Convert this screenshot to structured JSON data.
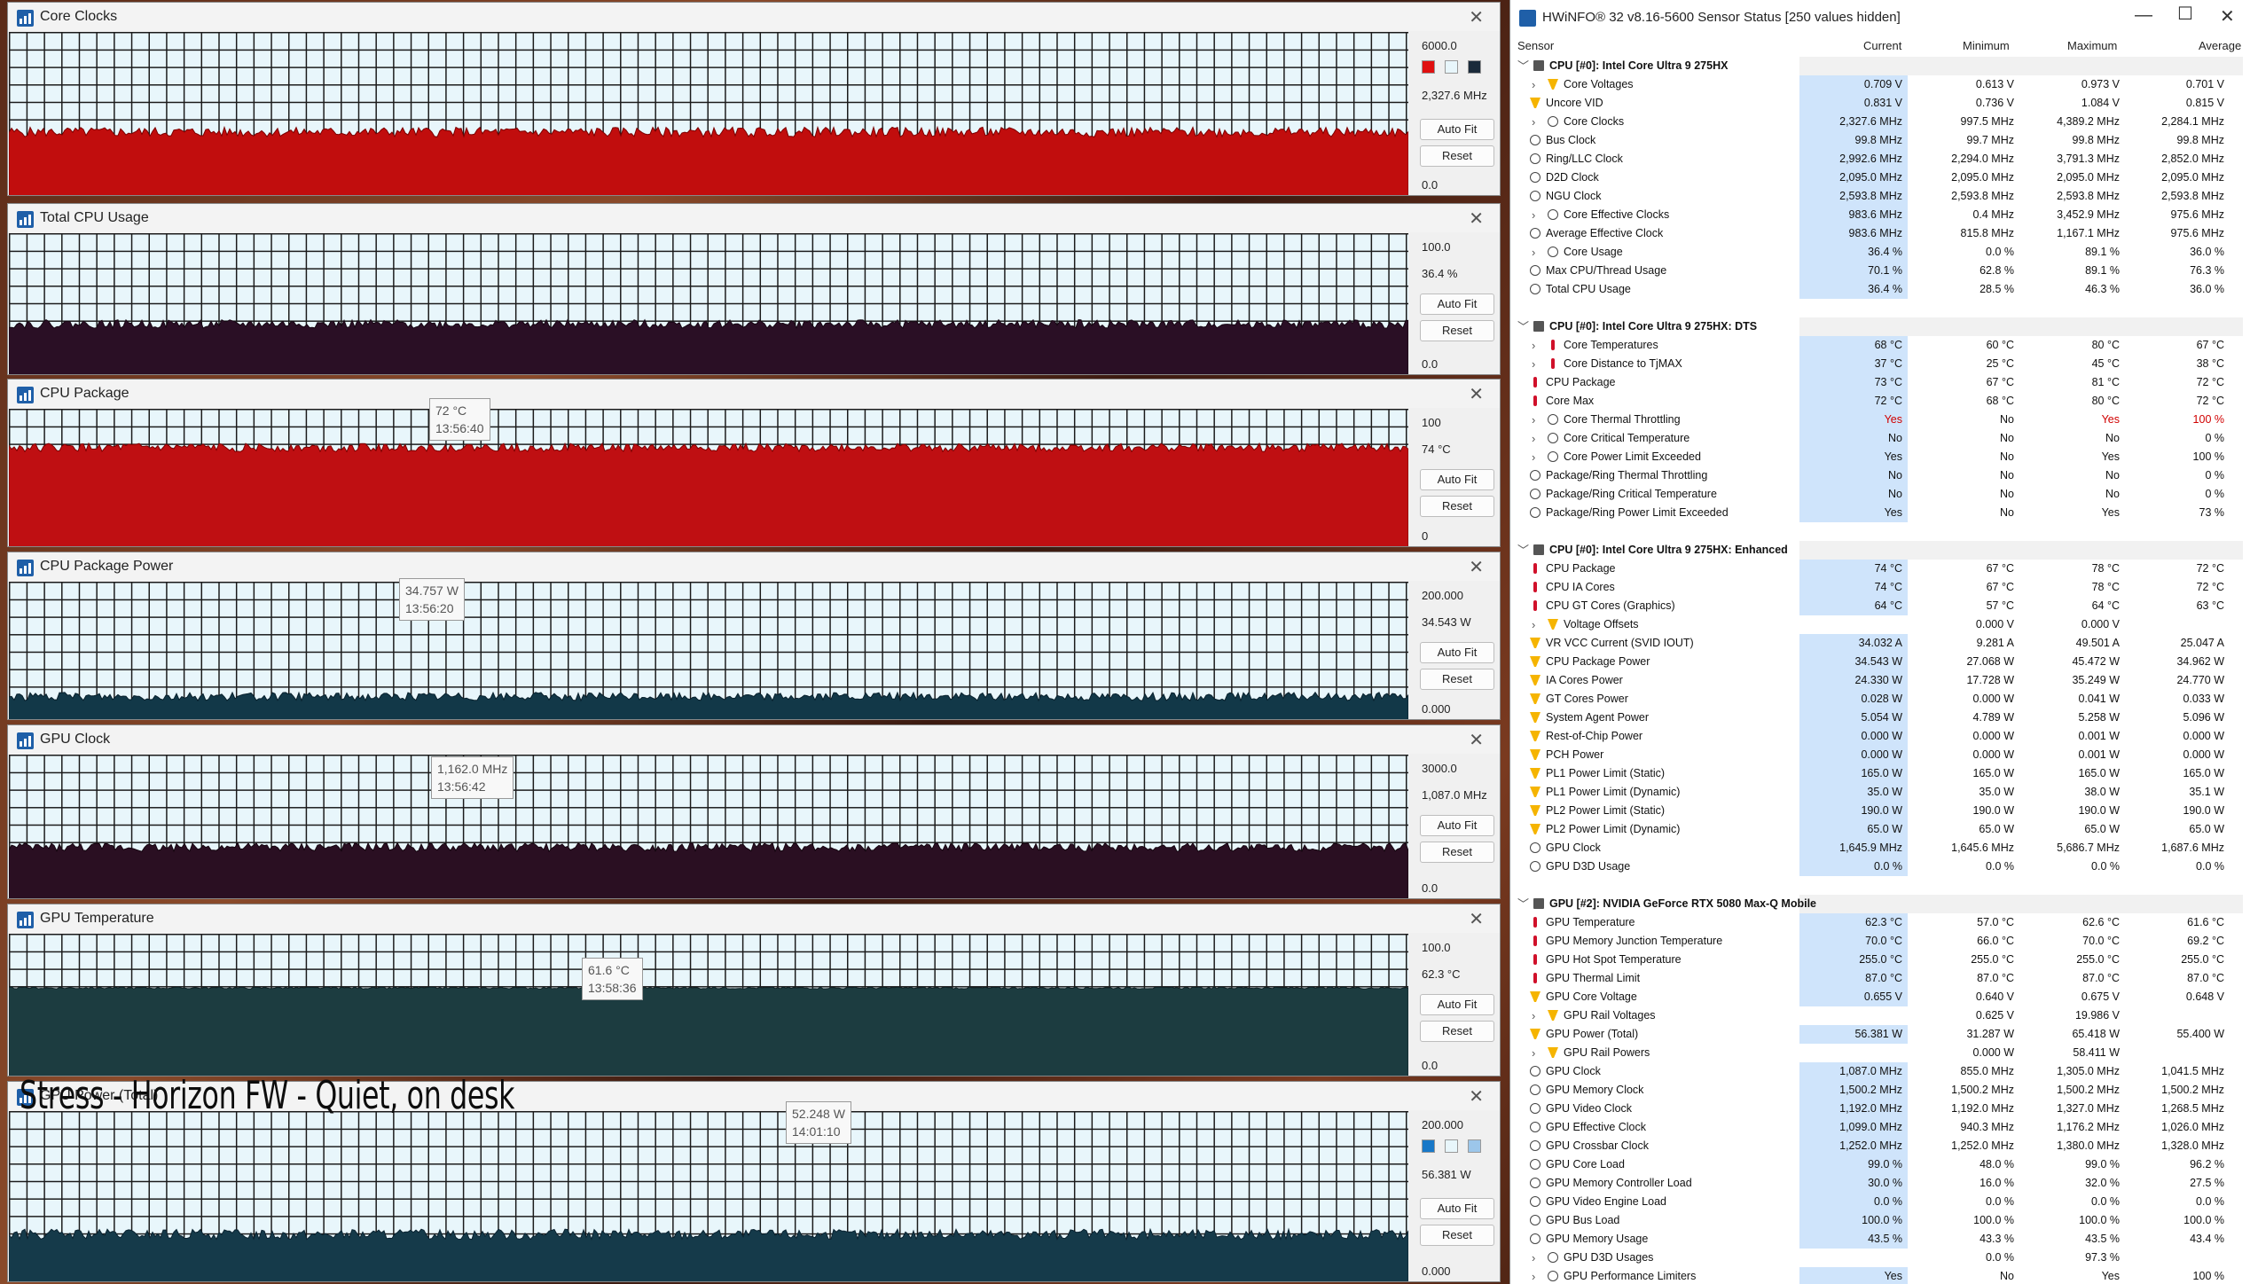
{
  "caption": "Stress - Horizon FW - Quiet, on desk",
  "graphs": [
    {
      "title": "Core Clocks",
      "max": "6000.0",
      "current": "2,327.6 MHz",
      "min": "0.0",
      "fill": "#c10d0d",
      "line": "#7a0000",
      "level": 0.39,
      "swatches": [
        "#e01010",
        "#e8f6fb",
        "#1a2a3a"
      ],
      "tooltip": null
    },
    {
      "title": "Total CPU Usage",
      "max": "100.0",
      "current": "36.4 %",
      "min": "0.0",
      "fill": "#2a0f25",
      "line": "#150612",
      "level": 0.36,
      "swatches": [],
      "tooltip": null
    },
    {
      "title": "CPU Package",
      "max": "100",
      "current": "74 °C",
      "min": "0",
      "fill": "#bf0f12",
      "line": "#7a0000",
      "level": 0.72,
      "swatches": [],
      "tooltip": {
        "value": "72 °C",
        "time": "13:56:40"
      }
    },
    {
      "title": "CPU Package Power",
      "max": "200.000",
      "current": "34.543 W",
      "min": "0.000",
      "fill": "#123848",
      "line": "#08202c",
      "level": 0.17,
      "swatches": [],
      "tooltip": {
        "value": "34.757 W",
        "time": "13:56:20"
      }
    },
    {
      "title": "GPU Clock",
      "max": "3000.0",
      "current": "1,087.0 MHz",
      "min": "0.0",
      "fill": "#2a0f22",
      "line": "#14050f",
      "level": 0.36,
      "swatches": [],
      "tooltip": {
        "value": "1,162.0 MHz",
        "time": "13:56:42"
      }
    },
    {
      "title": "GPU Temperature",
      "max": "100.0",
      "current": "62.3 °C",
      "min": "0.0",
      "fill": "#1c3c40",
      "line": "#102428",
      "level": 0.62,
      "swatches": [],
      "tooltip": {
        "value": "61.6 °C",
        "time": "13:58:36"
      }
    },
    {
      "title": "GPU Power (Total)",
      "max": "200.000",
      "current": "56.381 W",
      "min": "0.000",
      "fill": "#153a4a",
      "line": "#0a2230",
      "level": 0.28,
      "swatches": [
        "#1878c8",
        "#e8f6fb",
        "#9cc6ea"
      ],
      "tooltip": {
        "value": "52.248 W",
        "time": "14:01:10"
      }
    }
  ],
  "buttons": {
    "autofit": "Auto Fit",
    "reset": "Reset"
  },
  "hwinfo": {
    "title": "HWiNFO® 32 v8.16-5600 Sensor Status [250 values hidden]",
    "columns": {
      "sensor": "Sensor",
      "current": "Current",
      "minimum": "Minimum",
      "maximum": "Maximum",
      "average": "Average"
    },
    "rows": [
      {
        "t": "h",
        "n": "CPU [#0]: Intel Core Ultra 9 275HX"
      },
      {
        "t": "r",
        "i": "bolt",
        "e": 1,
        "n": "Core Voltages",
        "c": "0.709 V",
        "mi": "0.613 V",
        "ma": "0.973 V",
        "av": "0.701 V"
      },
      {
        "t": "r",
        "i": "bolt",
        "e": 0,
        "n": "Uncore VID",
        "c": "0.831 V",
        "mi": "0.736 V",
        "ma": "1.084 V",
        "av": "0.815 V"
      },
      {
        "t": "r",
        "i": "clock",
        "e": 1,
        "n": "Core Clocks",
        "c": "2,327.6 MHz",
        "mi": "997.5 MHz",
        "ma": "4,389.2 MHz",
        "av": "2,284.1 MHz"
      },
      {
        "t": "r",
        "i": "clock",
        "e": 0,
        "n": "Bus Clock",
        "c": "99.8 MHz",
        "mi": "99.7 MHz",
        "ma": "99.8 MHz",
        "av": "99.8 MHz"
      },
      {
        "t": "r",
        "i": "clock",
        "e": 0,
        "n": "Ring/LLC Clock",
        "c": "2,992.6 MHz",
        "mi": "2,294.0 MHz",
        "ma": "3,791.3 MHz",
        "av": "2,852.0 MHz"
      },
      {
        "t": "r",
        "i": "clock",
        "e": 0,
        "n": "D2D Clock",
        "c": "2,095.0 MHz",
        "mi": "2,095.0 MHz",
        "ma": "2,095.0 MHz",
        "av": "2,095.0 MHz"
      },
      {
        "t": "r",
        "i": "clock",
        "e": 0,
        "n": "NGU Clock",
        "c": "2,593.8 MHz",
        "mi": "2,593.8 MHz",
        "ma": "2,593.8 MHz",
        "av": "2,593.8 MHz"
      },
      {
        "t": "r",
        "i": "clock",
        "e": 1,
        "n": "Core Effective Clocks",
        "c": "983.6 MHz",
        "mi": "0.4 MHz",
        "ma": "3,452.9 MHz",
        "av": "975.6 MHz"
      },
      {
        "t": "r",
        "i": "clock",
        "e": 0,
        "n": "Average Effective Clock",
        "c": "983.6 MHz",
        "mi": "815.8 MHz",
        "ma": "1,167.1 MHz",
        "av": "975.6 MHz"
      },
      {
        "t": "r",
        "i": "clock",
        "e": 1,
        "n": "Core Usage",
        "c": "36.4 %",
        "mi": "0.0 %",
        "ma": "89.1 %",
        "av": "36.0 %"
      },
      {
        "t": "r",
        "i": "clock",
        "e": 0,
        "n": "Max CPU/Thread Usage",
        "c": "70.1 %",
        "mi": "62.8 %",
        "ma": "89.1 %",
        "av": "76.3 %"
      },
      {
        "t": "r",
        "i": "clock",
        "e": 0,
        "n": "Total CPU Usage",
        "c": "36.4 %",
        "mi": "28.5 %",
        "ma": "46.3 %",
        "av": "36.0 %"
      },
      {
        "t": "s"
      },
      {
        "t": "h",
        "n": "CPU [#0]: Intel Core Ultra 9 275HX: DTS"
      },
      {
        "t": "r",
        "i": "therm",
        "e": 1,
        "n": "Core Temperatures",
        "c": "68 °C",
        "mi": "60 °C",
        "ma": "80 °C",
        "av": "67 °C"
      },
      {
        "t": "r",
        "i": "therm",
        "e": 1,
        "n": "Core Distance to TjMAX",
        "c": "37 °C",
        "mi": "25 °C",
        "ma": "45 °C",
        "av": "38 °C"
      },
      {
        "t": "r",
        "i": "therm",
        "e": 0,
        "n": "CPU Package",
        "c": "73 °C",
        "mi": "67 °C",
        "ma": "81 °C",
        "av": "72 °C"
      },
      {
        "t": "r",
        "i": "therm",
        "e": 0,
        "n": "Core Max",
        "c": "72 °C",
        "mi": "68 °C",
        "ma": "80 °C",
        "av": "72 °C"
      },
      {
        "t": "r",
        "i": "clock",
        "e": 1,
        "n": "Core Thermal Throttling",
        "c": "Yes",
        "mi": "No",
        "ma": "Yes",
        "av": "100 %",
        "red": 1
      },
      {
        "t": "r",
        "i": "clock",
        "e": 1,
        "n": "Core Critical Temperature",
        "c": "No",
        "mi": "No",
        "ma": "No",
        "av": "0 %"
      },
      {
        "t": "r",
        "i": "clock",
        "e": 1,
        "n": "Core Power Limit Exceeded",
        "c": "Yes",
        "mi": "No",
        "ma": "Yes",
        "av": "100 %"
      },
      {
        "t": "r",
        "i": "clock",
        "e": 0,
        "n": "Package/Ring Thermal Throttling",
        "c": "No",
        "mi": "No",
        "ma": "No",
        "av": "0 %"
      },
      {
        "t": "r",
        "i": "clock",
        "e": 0,
        "n": "Package/Ring Critical Temperature",
        "c": "No",
        "mi": "No",
        "ma": "No",
        "av": "0 %"
      },
      {
        "t": "r",
        "i": "clock",
        "e": 0,
        "n": "Package/Ring Power Limit Exceeded",
        "c": "Yes",
        "mi": "No",
        "ma": "Yes",
        "av": "73 %"
      },
      {
        "t": "s"
      },
      {
        "t": "h",
        "n": "CPU [#0]: Intel Core Ultra 9 275HX: Enhanced"
      },
      {
        "t": "r",
        "i": "therm",
        "e": 0,
        "n": "CPU Package",
        "c": "74 °C",
        "mi": "67 °C",
        "ma": "78 °C",
        "av": "72 °C"
      },
      {
        "t": "r",
        "i": "therm",
        "e": 0,
        "n": "CPU IA Cores",
        "c": "74 °C",
        "mi": "67 °C",
        "ma": "78 °C",
        "av": "72 °C"
      },
      {
        "t": "r",
        "i": "therm",
        "e": 0,
        "n": "CPU GT Cores (Graphics)",
        "c": "64 °C",
        "mi": "57 °C",
        "ma": "64 °C",
        "av": "63 °C"
      },
      {
        "t": "r",
        "i": "bolt",
        "e": 1,
        "n": "Voltage Offsets",
        "c": "",
        "mi": "0.000 V",
        "ma": "0.000 V",
        "av": ""
      },
      {
        "t": "r",
        "i": "bolt",
        "e": 0,
        "n": "VR VCC Current (SVID IOUT)",
        "c": "34.032 A",
        "mi": "9.281 A",
        "ma": "49.501 A",
        "av": "25.047 A"
      },
      {
        "t": "r",
        "i": "bolt",
        "e": 0,
        "n": "CPU Package Power",
        "c": "34.543 W",
        "mi": "27.068 W",
        "ma": "45.472 W",
        "av": "34.962 W"
      },
      {
        "t": "r",
        "i": "bolt",
        "e": 0,
        "n": "IA Cores Power",
        "c": "24.330 W",
        "mi": "17.728 W",
        "ma": "35.249 W",
        "av": "24.770 W"
      },
      {
        "t": "r",
        "i": "bolt",
        "e": 0,
        "n": "GT Cores Power",
        "c": "0.028 W",
        "mi": "0.000 W",
        "ma": "0.041 W",
        "av": "0.033 W"
      },
      {
        "t": "r",
        "i": "bolt",
        "e": 0,
        "n": "System Agent Power",
        "c": "5.054 W",
        "mi": "4.789 W",
        "ma": "5.258 W",
        "av": "5.096 W"
      },
      {
        "t": "r",
        "i": "bolt",
        "e": 0,
        "n": "Rest-of-Chip Power",
        "c": "0.000 W",
        "mi": "0.000 W",
        "ma": "0.001 W",
        "av": "0.000 W"
      },
      {
        "t": "r",
        "i": "bolt",
        "e": 0,
        "n": "PCH Power",
        "c": "0.000 W",
        "mi": "0.000 W",
        "ma": "0.001 W",
        "av": "0.000 W"
      },
      {
        "t": "r",
        "i": "bolt",
        "e": 0,
        "n": "PL1 Power Limit (Static)",
        "c": "165.0 W",
        "mi": "165.0 W",
        "ma": "165.0 W",
        "av": "165.0 W"
      },
      {
        "t": "r",
        "i": "bolt",
        "e": 0,
        "n": "PL1 Power Limit (Dynamic)",
        "c": "35.0 W",
        "mi": "35.0 W",
        "ma": "38.0 W",
        "av": "35.1 W"
      },
      {
        "t": "r",
        "i": "bolt",
        "e": 0,
        "n": "PL2 Power Limit (Static)",
        "c": "190.0 W",
        "mi": "190.0 W",
        "ma": "190.0 W",
        "av": "190.0 W"
      },
      {
        "t": "r",
        "i": "bolt",
        "e": 0,
        "n": "PL2 Power Limit (Dynamic)",
        "c": "65.0 W",
        "mi": "65.0 W",
        "ma": "65.0 W",
        "av": "65.0 W"
      },
      {
        "t": "r",
        "i": "clock",
        "e": 0,
        "n": "GPU Clock",
        "c": "1,645.9 MHz",
        "mi": "1,645.6 MHz",
        "ma": "5,686.7 MHz",
        "av": "1,687.6 MHz"
      },
      {
        "t": "r",
        "i": "clock",
        "e": 0,
        "n": "GPU D3D Usage",
        "c": "0.0 %",
        "mi": "0.0 %",
        "ma": "0.0 %",
        "av": "0.0 %"
      },
      {
        "t": "s"
      },
      {
        "t": "h",
        "n": "GPU [#2]: NVIDIA  GeForce RTX 5080 Max-Q Mobile"
      },
      {
        "t": "r",
        "i": "therm",
        "e": 0,
        "n": "GPU Temperature",
        "c": "62.3 °C",
        "mi": "57.0 °C",
        "ma": "62.6 °C",
        "av": "61.6 °C"
      },
      {
        "t": "r",
        "i": "therm",
        "e": 0,
        "n": "GPU Memory Junction Temperature",
        "c": "70.0 °C",
        "mi": "66.0 °C",
        "ma": "70.0 °C",
        "av": "69.2 °C"
      },
      {
        "t": "r",
        "i": "therm",
        "e": 0,
        "n": "GPU Hot Spot Temperature",
        "c": "255.0 °C",
        "mi": "255.0 °C",
        "ma": "255.0 °C",
        "av": "255.0 °C"
      },
      {
        "t": "r",
        "i": "therm",
        "e": 0,
        "n": "GPU Thermal Limit",
        "c": "87.0 °C",
        "mi": "87.0 °C",
        "ma": "87.0 °C",
        "av": "87.0 °C"
      },
      {
        "t": "r",
        "i": "bolt",
        "e": 0,
        "n": "GPU Core Voltage",
        "c": "0.655 V",
        "mi": "0.640 V",
        "ma": "0.675 V",
        "av": "0.648 V"
      },
      {
        "t": "r",
        "i": "bolt",
        "e": 1,
        "n": "GPU Rail Voltages",
        "c": "",
        "mi": "0.625 V",
        "ma": "19.986 V",
        "av": ""
      },
      {
        "t": "r",
        "i": "bolt",
        "e": 0,
        "n": "GPU Power (Total)",
        "c": "56.381 W",
        "mi": "31.287 W",
        "ma": "65.418 W",
        "av": "55.400 W"
      },
      {
        "t": "r",
        "i": "bolt",
        "e": 1,
        "n": "GPU Rail Powers",
        "c": "",
        "mi": "0.000 W",
        "ma": "58.411 W",
        "av": ""
      },
      {
        "t": "r",
        "i": "clock",
        "e": 0,
        "n": "GPU Clock",
        "c": "1,087.0 MHz",
        "mi": "855.0 MHz",
        "ma": "1,305.0 MHz",
        "av": "1,041.5 MHz"
      },
      {
        "t": "r",
        "i": "clock",
        "e": 0,
        "n": "GPU Memory Clock",
        "c": "1,500.2 MHz",
        "mi": "1,500.2 MHz",
        "ma": "1,500.2 MHz",
        "av": "1,500.2 MHz"
      },
      {
        "t": "r",
        "i": "clock",
        "e": 0,
        "n": "GPU Video Clock",
        "c": "1,192.0 MHz",
        "mi": "1,192.0 MHz",
        "ma": "1,327.0 MHz",
        "av": "1,268.5 MHz"
      },
      {
        "t": "r",
        "i": "clock",
        "e": 0,
        "n": "GPU Effective Clock",
        "c": "1,099.0 MHz",
        "mi": "940.3 MHz",
        "ma": "1,176.2 MHz",
        "av": "1,026.0 MHz"
      },
      {
        "t": "r",
        "i": "clock",
        "e": 0,
        "n": "GPU Crossbar Clock",
        "c": "1,252.0 MHz",
        "mi": "1,252.0 MHz",
        "ma": "1,380.0 MHz",
        "av": "1,328.0 MHz"
      },
      {
        "t": "r",
        "i": "clock",
        "e": 0,
        "n": "GPU Core Load",
        "c": "99.0 %",
        "mi": "48.0 %",
        "ma": "99.0 %",
        "av": "96.2 %"
      },
      {
        "t": "r",
        "i": "clock",
        "e": 0,
        "n": "GPU Memory Controller Load",
        "c": "30.0 %",
        "mi": "16.0 %",
        "ma": "32.0 %",
        "av": "27.5 %"
      },
      {
        "t": "r",
        "i": "clock",
        "e": 0,
        "n": "GPU Video Engine Load",
        "c": "0.0 %",
        "mi": "0.0 %",
        "ma": "0.0 %",
        "av": "0.0 %"
      },
      {
        "t": "r",
        "i": "clock",
        "e": 0,
        "n": "GPU Bus Load",
        "c": "100.0 %",
        "mi": "100.0 %",
        "ma": "100.0 %",
        "av": "100.0 %"
      },
      {
        "t": "r",
        "i": "clock",
        "e": 0,
        "n": "GPU Memory Usage",
        "c": "43.5 %",
        "mi": "43.3 %",
        "ma": "43.5 %",
        "av": "43.4 %"
      },
      {
        "t": "r",
        "i": "clock",
        "e": 1,
        "n": "GPU D3D Usages",
        "c": "",
        "mi": "0.0 %",
        "ma": "97.3 %",
        "av": ""
      },
      {
        "t": "r",
        "i": "clock",
        "e": 1,
        "n": "GPU Performance Limiters",
        "c": "Yes",
        "mi": "No",
        "ma": "Yes",
        "av": "100 %"
      }
    ]
  },
  "colors": {
    "current_cell": "#cfe4fb",
    "alert": "#d00000",
    "accent": "#1f5fa8"
  }
}
